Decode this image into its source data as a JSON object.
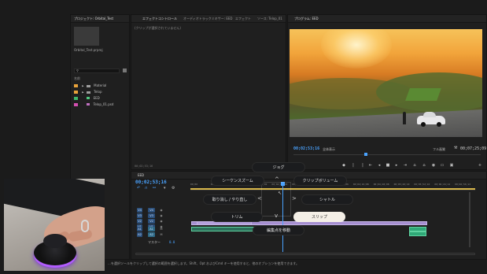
{
  "project": {
    "tab": "プロジェクト: Orbital_Test",
    "file": "Orbital_Test.prproj",
    "column_header": "名前",
    "items": [
      {
        "label": "Material",
        "color": "#e8a23a",
        "kind": "folder"
      },
      {
        "label": "Telop",
        "color": "#e8a23a",
        "kind": "folder"
      },
      {
        "label": "EED",
        "color": "#3fb86a",
        "kind": "file"
      },
      {
        "label": "Telop_01.psd",
        "color": "#d24fb0",
        "kind": "file"
      }
    ]
  },
  "effects": {
    "tabs": [
      "エフェクトコントロール",
      "オーディオトラックミキサー: EED",
      "エフェクト",
      "ソース: Telop_01"
    ],
    "empty_text": "(クリップが選択されていません)",
    "timecode": "00;02;53;16"
  },
  "program": {
    "tab": "プログラム: EED",
    "timecode": "00;02;53;16",
    "fit_label": "全体表示",
    "quality": "フル画質",
    "duration": "00;07;25;09"
  },
  "timeline": {
    "tab": "EED",
    "timecode": "00;02;53;16",
    "ruler": [
      "00;00",
      "00;00;32;00",
      "00;01;04;02",
      "00;01;36;02",
      "00;02;08;04",
      "00;02;40;04",
      "00;03;12;06",
      "00;03;44;06",
      "00;04;16;08",
      "00;04;48;08",
      "00;05;20;10",
      "00;05;52;10",
      "00;06;24;12",
      "00;06;56;12"
    ],
    "video_tracks": [
      "V4",
      "V3",
      "V2",
      "V1"
    ],
    "audio_tracks": [
      "A1",
      "A2"
    ],
    "master": "マスター",
    "master_value": "0.0"
  },
  "radial_menu": {
    "top": "ジョグ",
    "left_upper": "シーケンスズーム",
    "right_upper": "クリップボリューム",
    "left_middle": "取り消し / やり直し",
    "right_middle": "シャトル",
    "left_lower": "トリム",
    "right_lower": "スリップ",
    "bottom": "編集点を移動",
    "active_color": "#f4efe6"
  },
  "status_bar": {
    "text": "…を選択ツールをクリップして選択の範囲を選択します。Shift、Opt およびCmd キーを使用すると、他のオプションを使用できます。"
  }
}
